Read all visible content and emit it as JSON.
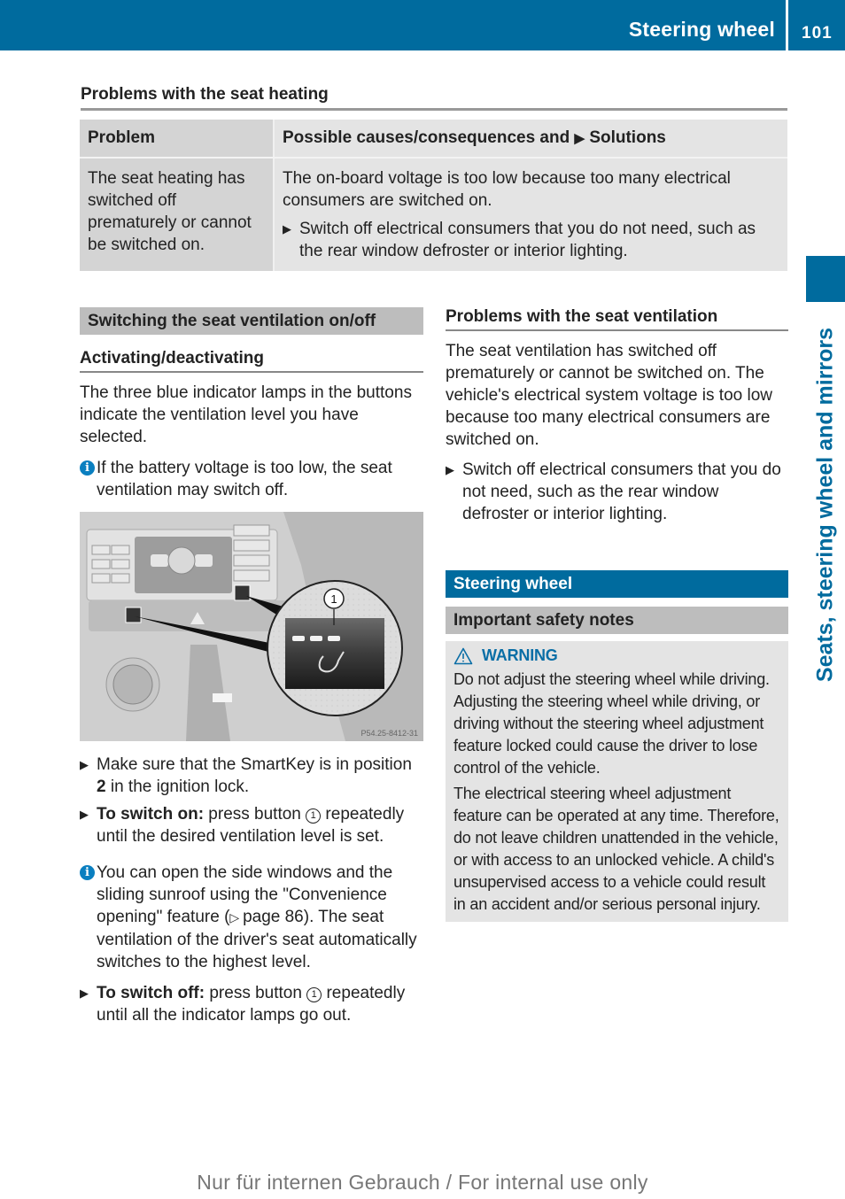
{
  "header": {
    "title": "Steering wheel",
    "page_number": "101"
  },
  "side_tab": {
    "label": "Seats, steering wheel and mirrors"
  },
  "seat_heating": {
    "heading": "Problems with the seat heating",
    "table": {
      "columns": [
        "Problem",
        "Possible causes/consequences and",
        "Solutions"
      ],
      "rows": [
        {
          "problem": "The seat heating has switched off prematurely or cannot be switched on.",
          "cause": "The on-board voltage is too low because too many electrical consumers are switched on.",
          "solution": "Switch off electrical consumers that you do not need, such as the rear window defroster or interior lighting."
        }
      ]
    }
  },
  "ventilation": {
    "section_title": "Switching the seat ventilation on/off",
    "subheading": "Activating/deactivating",
    "intro": "The three blue indicator lamps in the buttons indicate the ventilation level you have selected.",
    "note1": "If the battery voltage is too low, the seat ventilation may switch off.",
    "figure": {
      "callout": "1",
      "code": "P54.25-8412-31"
    },
    "step1_pre": "Make sure that the SmartKey is in position ",
    "step1_bold": "2",
    "step1_post": " in the ignition lock.",
    "step2_bold": "To switch on:",
    "step2_pre": " press button ",
    "step2_post": " repeatedly until the desired ventilation level is set.",
    "note2_pre": "You can open the side windows and the sliding sunroof using the \"Convenience opening\" feature (",
    "note2_ref": "page 86",
    "note2_post": "). The seat ventilation of the driver's seat automatically switches to the highest level.",
    "step3_bold": "To switch off:",
    "step3_pre": " press button ",
    "step3_post": " repeatedly until all the indicator lamps go out.",
    "button_ref": "1"
  },
  "ventilation_problems": {
    "heading": "Problems with the seat ventilation",
    "text": "The seat ventilation has switched off prematurely or cannot be switched on. The vehicle's electrical system voltage is too low because too many electrical consumers are switched on.",
    "step": "Switch off electrical consumers that you do not need, such as the rear window defroster or interior lighting."
  },
  "steering": {
    "section_title": "Steering wheel",
    "subsection_title": "Important safety notes",
    "warning_label": "WARNING",
    "warning_p1": "Do not adjust the steering wheel while driving. Adjusting the steering wheel while driving, or driving without the steering wheel adjustment feature locked could cause the driver to lose control of the vehicle.",
    "warning_p2": "The electrical steering wheel adjustment feature can be operated at any time. Therefore, do not leave children unattended in the vehicle, or with access to an unlocked vehicle. A child's unsupervised access to a vehicle could result in an accident and/or serious personal injury."
  },
  "footer": {
    "text": "Nur für internen Gebrauch / For internal use only"
  },
  "colors": {
    "brand_blue": "#006b9e",
    "warning_blue": "#0a6ea6"
  }
}
